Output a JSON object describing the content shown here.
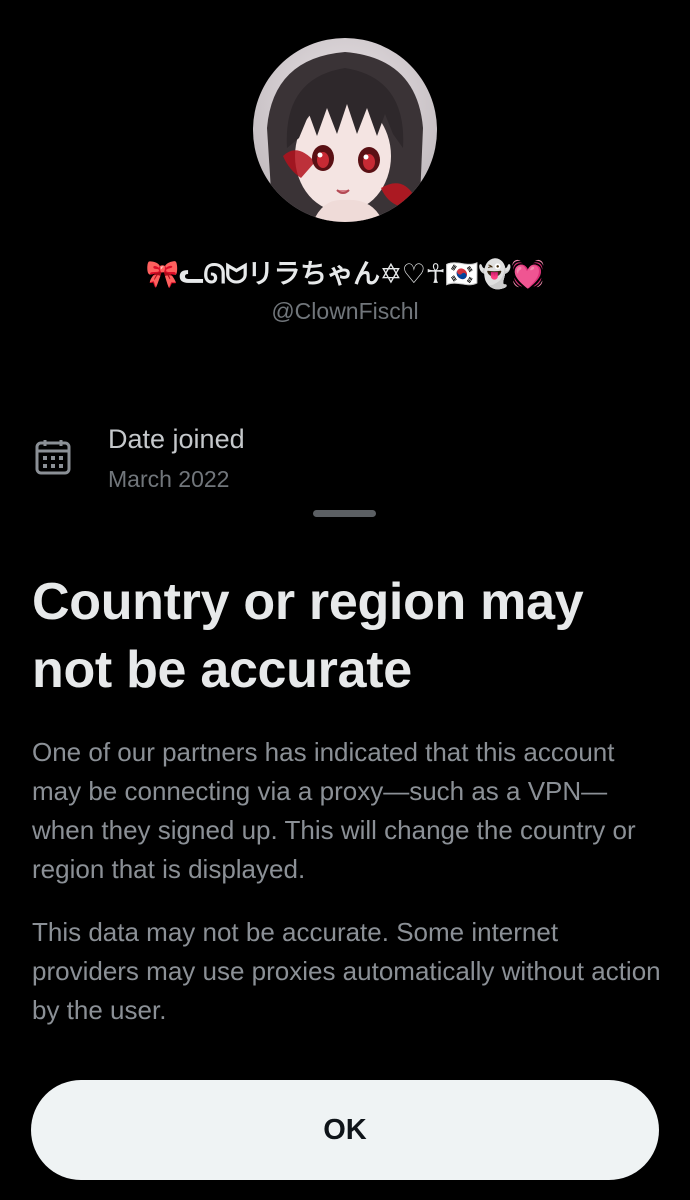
{
  "profile": {
    "display_name": "🎀ᓚᘏᗢリラちゃん✡♡☥🇰🇷👻💓",
    "handle": "@ClownFischl",
    "avatar_icon": "anime-avatar-icon"
  },
  "date_joined": {
    "icon": "calendar-icon",
    "label": "Date joined",
    "value": "March 2022"
  },
  "sheet": {
    "title": "Country or region may not be accurate",
    "paragraph_1": "One of our partners has indicated that this account may be connecting via a proxy—such as a VPN—when they signed up. This will change the country or region that is displayed.",
    "paragraph_2": "This data may not be accurate. Some internet providers may use proxies automatically without action by the user.",
    "ok_label": "OK"
  },
  "colors": {
    "background": "#000000",
    "primary_text": "#e7e9ea",
    "secondary_text": "#71767b",
    "body_text": "#8b9096",
    "button_bg": "#eff3f4",
    "button_text": "#0f1419"
  }
}
